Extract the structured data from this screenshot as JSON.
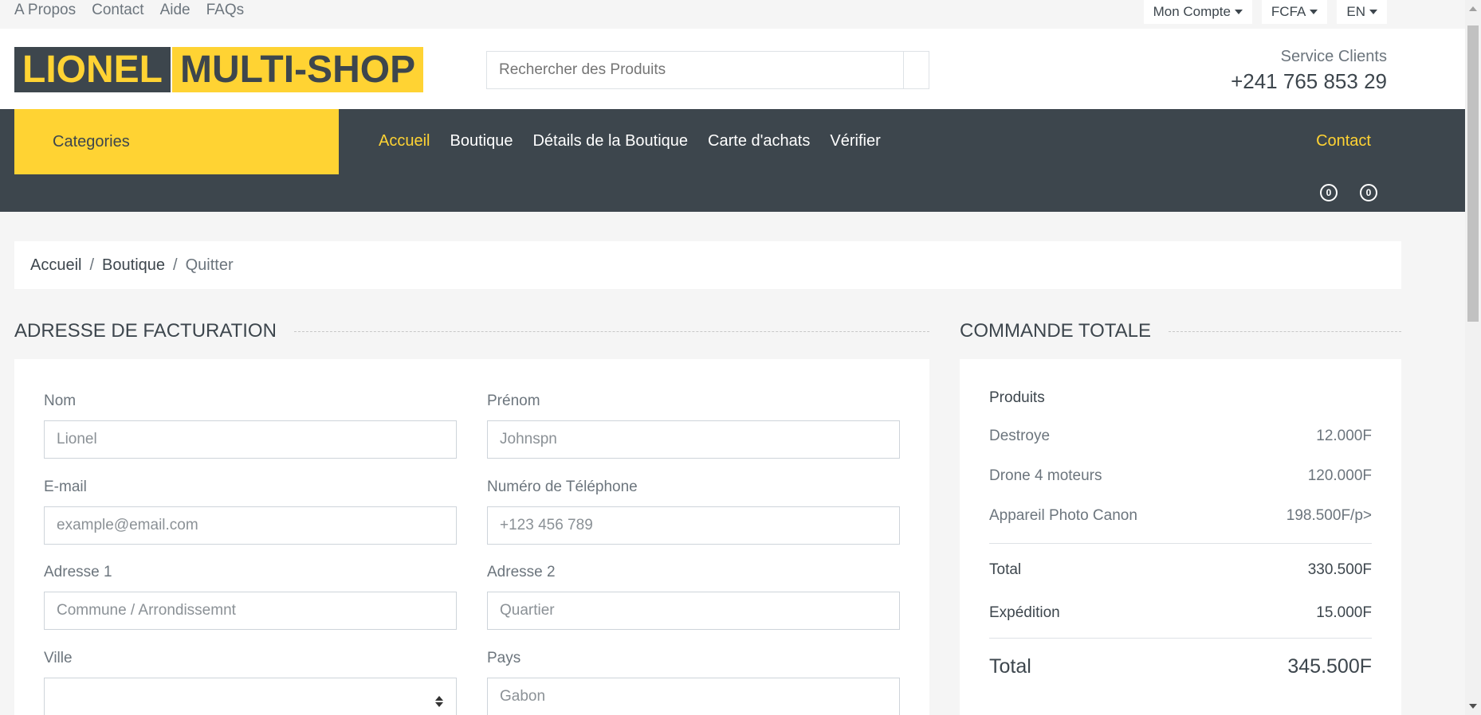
{
  "topbar": {
    "links": [
      "A Propos",
      "Contact",
      "Aide",
      "FAQs"
    ],
    "account": "Mon Compte",
    "currency": "FCFA",
    "language": "EN"
  },
  "header": {
    "logo_part1": "LIONEL",
    "logo_part2": "MULTI-SHOP",
    "search_placeholder": "Rechercher des Produits",
    "service_label": "Service Clients",
    "service_phone": "+241 765 853 29"
  },
  "nav": {
    "categories": "Categories",
    "items": [
      "Accueil",
      "Boutique",
      "Détails de la Boutique",
      "Carte d'achats",
      "Vérifier"
    ],
    "contact": "Contact",
    "wishlist_count": "0",
    "cart_count": "0"
  },
  "breadcrumb": {
    "home": "Accueil",
    "shop": "Boutique",
    "current": "Quitter",
    "separator": "/"
  },
  "billing": {
    "title": "ADRESSE DE FACTURATION",
    "fields": {
      "nom": {
        "label": "Nom",
        "placeholder": "Lionel"
      },
      "prenom": {
        "label": "Prénom",
        "placeholder": "Johnspn"
      },
      "email": {
        "label": "E-mail",
        "placeholder": "example@email.com"
      },
      "phone": {
        "label": "Numéro de Téléphone",
        "placeholder": "+123 456 789"
      },
      "address1": {
        "label": "Adresse 1",
        "placeholder": "Commune / Arrondissemnt"
      },
      "address2": {
        "label": "Adresse 2",
        "placeholder": "Quartier"
      },
      "ville": {
        "label": "Ville",
        "value": ""
      },
      "pays": {
        "label": "Pays",
        "placeholder": "Gabon"
      }
    }
  },
  "order": {
    "title": "COMMANDE TOTALE",
    "products_heading": "Produits",
    "products": [
      {
        "name": "Destroye",
        "price": "12.000F"
      },
      {
        "name": "Drone 4 moteurs",
        "price": "120.000F"
      },
      {
        "name": "Appareil Photo Canon",
        "price": "198.500F/p>"
      }
    ],
    "subtotal_label": "Total",
    "subtotal_value": "330.500F",
    "shipping_label": "Expédition",
    "shipping_value": "15.000F",
    "total_label": "Total",
    "total_value": "345.500F"
  },
  "colors": {
    "accent": "#ffd333",
    "dark": "#3d464d"
  }
}
